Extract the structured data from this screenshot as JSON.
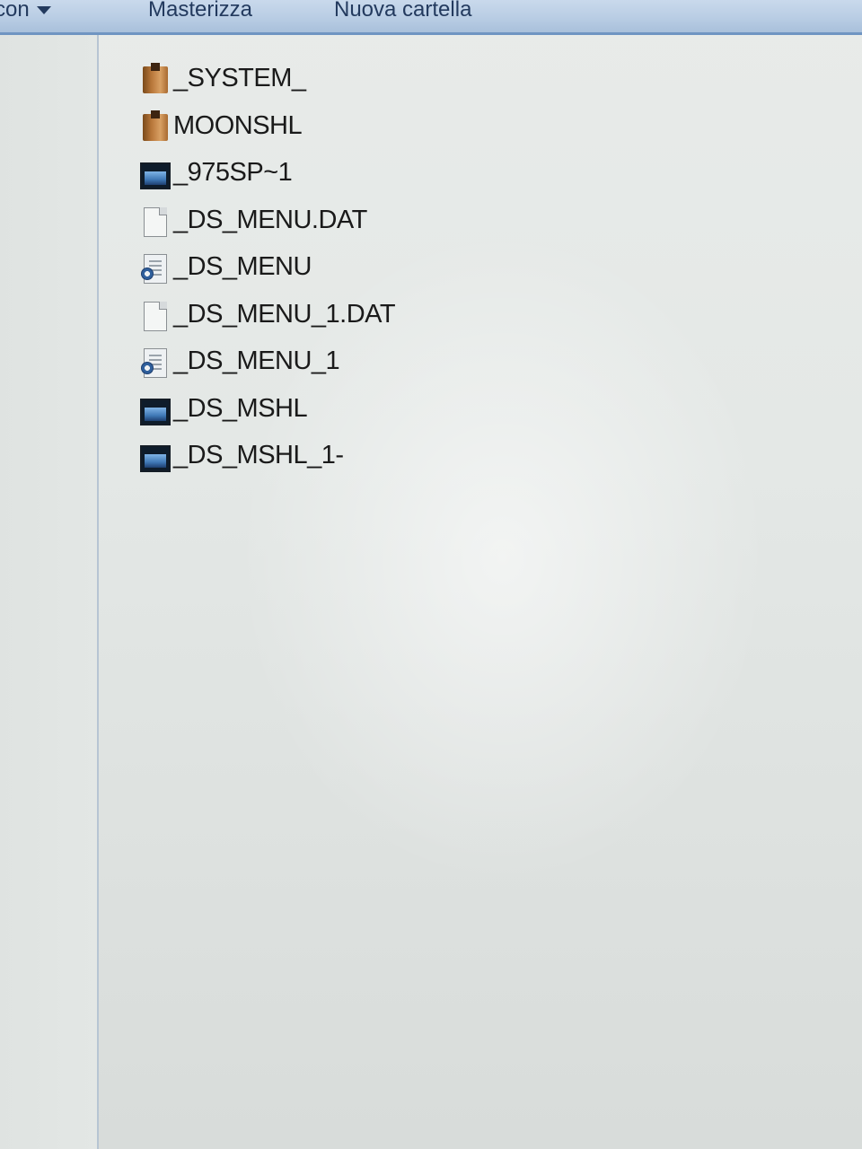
{
  "toolbar": {
    "share_label": "con",
    "burn_label": "Masterizza",
    "new_folder_label": "Nuova cartella"
  },
  "files": [
    {
      "name": "_SYSTEM_",
      "icon": "folder-icon"
    },
    {
      "name": "MOONSHL",
      "icon": "folder-icon"
    },
    {
      "name": "_975SP~1",
      "icon": "application-icon"
    },
    {
      "name": "_DS_MENU.DAT",
      "icon": "document-icon"
    },
    {
      "name": "_DS_MENU",
      "icon": "system-file-icon"
    },
    {
      "name": "_DS_MENU_1.DAT",
      "icon": "document-icon"
    },
    {
      "name": "_DS_MENU_1",
      "icon": "system-file-icon"
    },
    {
      "name": "_DS_MSHL",
      "icon": "application-icon"
    },
    {
      "name": "_DS_MSHL_1-",
      "icon": "application-icon"
    }
  ],
  "colors": {
    "toolbar": "#b9cde4",
    "toolbar_border": "#6f95c2",
    "background": "#e4e8e6"
  }
}
